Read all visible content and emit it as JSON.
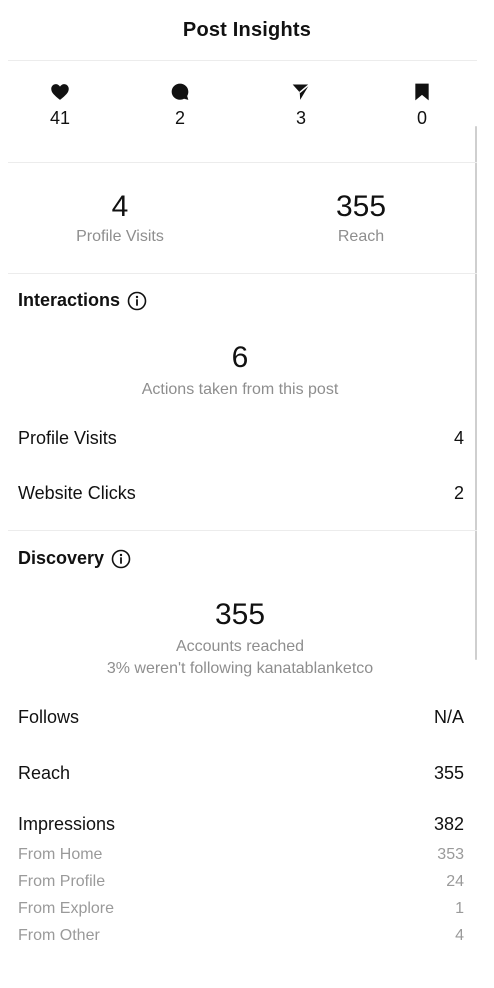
{
  "header": {
    "title": "Post Insights"
  },
  "stats": [
    {
      "icon": "heart-icon",
      "value": "41"
    },
    {
      "icon": "comment-icon",
      "value": "2"
    },
    {
      "icon": "send-icon",
      "value": "3"
    },
    {
      "icon": "bookmark-icon",
      "value": "0"
    }
  ],
  "summary": [
    {
      "value": "4",
      "label": "Profile Visits"
    },
    {
      "value": "355",
      "label": "Reach"
    }
  ],
  "interactions": {
    "title": "Interactions",
    "total": "6",
    "total_label": "Actions taken from this post",
    "rows": [
      {
        "label": "Profile Visits",
        "value": "4"
      },
      {
        "label": "Website Clicks",
        "value": "2"
      }
    ]
  },
  "discovery": {
    "title": "Discovery",
    "total": "355",
    "total_label": "Accounts reached",
    "subtitle": "3% weren't following kanatablanketco",
    "rows": [
      {
        "label": "Follows",
        "value": "N/A"
      },
      {
        "label": "Reach",
        "value": "355"
      },
      {
        "label": "Impressions",
        "value": "382"
      }
    ],
    "impressions_breakdown": [
      {
        "label": "From Home",
        "value": "353"
      },
      {
        "label": "From Profile",
        "value": "24"
      },
      {
        "label": "From Explore",
        "value": "1"
      },
      {
        "label": "From Other",
        "value": "4"
      }
    ]
  },
  "colors": {
    "text": "#111111",
    "muted": "#8e8e8e",
    "divider": "#ececec"
  }
}
